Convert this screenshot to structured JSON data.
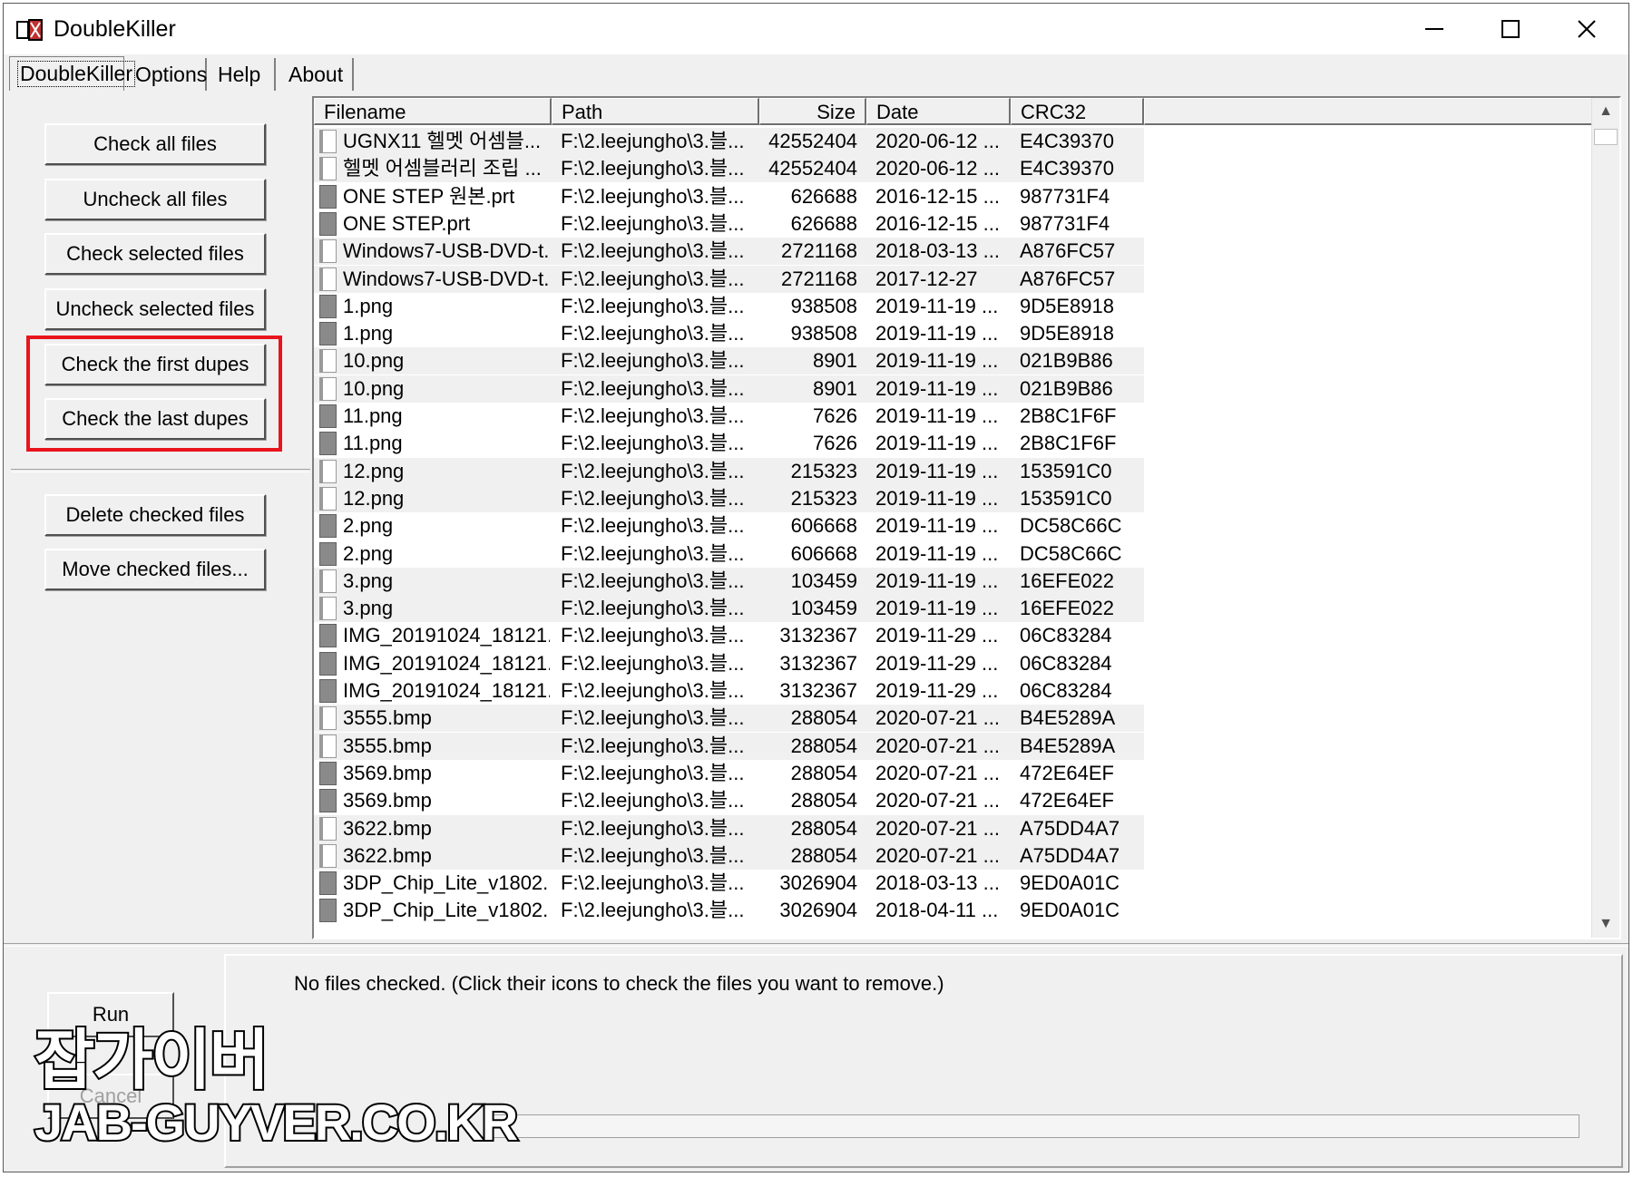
{
  "window": {
    "title": "DoubleKiller",
    "icon": "doublekiller-app-icon",
    "controls": [
      "minimize-icon",
      "maximize-icon",
      "close-icon"
    ]
  },
  "tabs": [
    {
      "label": "DoubleKiller",
      "active": true
    },
    {
      "label": "Options"
    },
    {
      "label": "Help"
    },
    {
      "label": "About"
    }
  ],
  "buttons": {
    "check_all": "Check all files",
    "uncheck_all": "Uncheck all files",
    "check_selected": "Check selected files",
    "uncheck_selected": "Uncheck selected files",
    "check_first_dupes": "Check the first dupes",
    "check_last_dupes": "Check the last dupes",
    "delete_checked": "Delete checked files",
    "move_checked": "Move checked files..."
  },
  "highlight_color": "#e8141c",
  "columns": [
    "Filename",
    "Path",
    "Size",
    "Date",
    "CRC32"
  ],
  "rows": [
    [
      "UGNX11 헬멧 어셈블...",
      "F:\\2.leejungho\\3.블...",
      "42552404",
      "2020-06-12 ...",
      "E4C39370"
    ],
    [
      "헬멧 어셈블러리 조립 ...",
      "F:\\2.leejungho\\3.블...",
      "42552404",
      "2020-06-12 ...",
      "E4C39370"
    ],
    [
      "ONE STEP 원본.prt",
      "F:\\2.leejungho\\3.블...",
      "626688",
      "2016-12-15 ...",
      "987731F4"
    ],
    [
      "ONE STEP.prt",
      "F:\\2.leejungho\\3.블...",
      "626688",
      "2016-12-15 ...",
      "987731F4"
    ],
    [
      "Windows7-USB-DVD-t...",
      "F:\\2.leejungho\\3.블...",
      "2721168",
      "2018-03-13 ...",
      "A876FC57"
    ],
    [
      "Windows7-USB-DVD-t...",
      "F:\\2.leejungho\\3.블...",
      "2721168",
      "2017-12-27",
      "A876FC57"
    ],
    [
      "1.png",
      "F:\\2.leejungho\\3.블...",
      "938508",
      "2019-11-19 ...",
      "9D5E8918"
    ],
    [
      "1.png",
      "F:\\2.leejungho\\3.블...",
      "938508",
      "2019-11-19 ...",
      "9D5E8918"
    ],
    [
      "10.png",
      "F:\\2.leejungho\\3.블...",
      "8901",
      "2019-11-19 ...",
      "021B9B86"
    ],
    [
      "10.png",
      "F:\\2.leejungho\\3.블...",
      "8901",
      "2019-11-19 ...",
      "021B9B86"
    ],
    [
      "11.png",
      "F:\\2.leejungho\\3.블...",
      "7626",
      "2019-11-19 ...",
      "2B8C1F6F"
    ],
    [
      "11.png",
      "F:\\2.leejungho\\3.블...",
      "7626",
      "2019-11-19 ...",
      "2B8C1F6F"
    ],
    [
      "12.png",
      "F:\\2.leejungho\\3.블...",
      "215323",
      "2019-11-19 ...",
      "153591C0"
    ],
    [
      "12.png",
      "F:\\2.leejungho\\3.블...",
      "215323",
      "2019-11-19 ...",
      "153591C0"
    ],
    [
      "2.png",
      "F:\\2.leejungho\\3.블...",
      "606668",
      "2019-11-19 ...",
      "DC58C66C"
    ],
    [
      "2.png",
      "F:\\2.leejungho\\3.블...",
      "606668",
      "2019-11-19 ...",
      "DC58C66C"
    ],
    [
      "3.png",
      "F:\\2.leejungho\\3.블...",
      "103459",
      "2019-11-19 ...",
      "16EFE022"
    ],
    [
      "3.png",
      "F:\\2.leejungho\\3.블...",
      "103459",
      "2019-11-19 ...",
      "16EFE022"
    ],
    [
      "IMG_20191024_18121...",
      "F:\\2.leejungho\\3.블...",
      "3132367",
      "2019-11-29 ...",
      "06C83284"
    ],
    [
      "IMG_20191024_18121...",
      "F:\\2.leejungho\\3.블...",
      "3132367",
      "2019-11-29 ...",
      "06C83284"
    ],
    [
      "IMG_20191024_18121...",
      "F:\\2.leejungho\\3.블...",
      "3132367",
      "2019-11-29 ...",
      "06C83284"
    ],
    [
      "3555.bmp",
      "F:\\2.leejungho\\3.블...",
      "288054",
      "2020-07-21 ...",
      "B4E5289A"
    ],
    [
      "3555.bmp",
      "F:\\2.leejungho\\3.블...",
      "288054",
      "2020-07-21 ...",
      "B4E5289A"
    ],
    [
      "3569.bmp",
      "F:\\2.leejungho\\3.블...",
      "288054",
      "2020-07-21 ...",
      "472E64EF"
    ],
    [
      "3569.bmp",
      "F:\\2.leejungho\\3.블...",
      "288054",
      "2020-07-21 ...",
      "472E64EF"
    ],
    [
      "3622.bmp",
      "F:\\2.leejungho\\3.블...",
      "288054",
      "2020-07-21 ...",
      "A75DD4A7"
    ],
    [
      "3622.bmp",
      "F:\\2.leejungho\\3.블...",
      "288054",
      "2020-07-21 ...",
      "A75DD4A7"
    ],
    [
      "3DP_Chip_Lite_v1802....",
      "F:\\2.leejungho\\3.블...",
      "3026904",
      "2018-03-13 ...",
      "9ED0A01C"
    ],
    [
      "3DP_Chip_Lite_v1802....",
      "F:\\2.leejungho\\3.블...",
      "3026904",
      "2018-04-11 ...",
      "9ED0A01C"
    ]
  ],
  "row_icons": [
    "file-unchecked-icon",
    "file-unchecked-icon",
    "file-checked-icon",
    "file-checked-icon",
    "file-unchecked-icon",
    "file-unchecked-icon",
    "file-checked-icon",
    "file-checked-icon",
    "file-unchecked-icon",
    "file-unchecked-icon",
    "file-checked-icon",
    "file-checked-icon",
    "file-unchecked-icon",
    "file-unchecked-icon",
    "file-checked-icon",
    "file-checked-icon",
    "file-unchecked-icon",
    "file-unchecked-icon",
    "file-checked-icon",
    "file-checked-icon",
    "file-checked-icon",
    "file-unchecked-icon",
    "file-unchecked-icon",
    "file-checked-icon",
    "file-checked-icon",
    "file-unchecked-icon",
    "file-unchecked-icon",
    "file-checked-icon",
    "file-checked-icon"
  ],
  "row_shaded": [
    true,
    true,
    false,
    false,
    true,
    true,
    false,
    false,
    true,
    true,
    false,
    false,
    true,
    true,
    false,
    false,
    true,
    true,
    false,
    false,
    false,
    true,
    true,
    false,
    false,
    true,
    true,
    false,
    false
  ],
  "status": {
    "message": "No files checked. (Click their icons to check the files you want to remove.)",
    "run_label": "Run",
    "cancel_label": "Cancel"
  },
  "watermark": {
    "line1": "잡가이버",
    "line2": "JAB-GUYVER.CO.KR"
  }
}
